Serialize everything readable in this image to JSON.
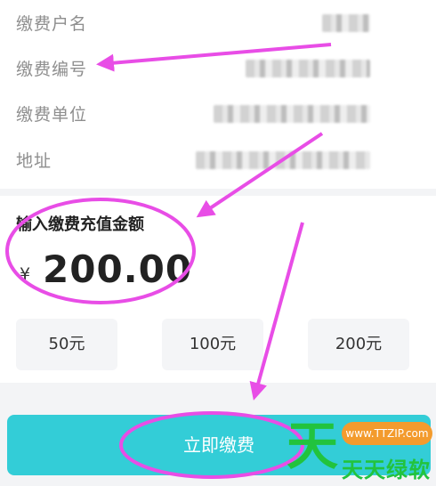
{
  "info": {
    "rows": [
      {
        "label": "缴费户名",
        "value": "██"
      },
      {
        "label": "缴费编号",
        "value": "██████████"
      },
      {
        "label": "缴费单位",
        "value": "██████████"
      },
      {
        "label": "地址",
        "value": "████████████"
      }
    ]
  },
  "amount": {
    "title": "输入缴费充值金额",
    "currency": "¥",
    "value": "200.00",
    "presets": [
      "50元",
      "100元",
      "200元"
    ]
  },
  "pay_button": {
    "label": "立即缴费"
  },
  "watermark": {
    "url": "www.TTZIP.com",
    "big_char": "天",
    "brand": "天天绿软"
  },
  "colors": {
    "accent": "#33cdd7",
    "annotation": "#e84de6",
    "watermark_green": "#22c33d",
    "watermark_orange": "#f39b2d"
  }
}
